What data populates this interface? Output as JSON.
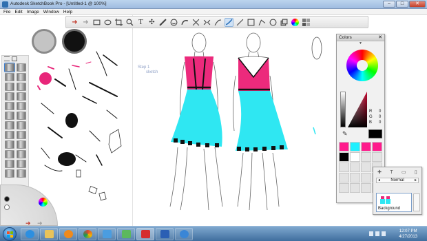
{
  "window": {
    "title": "Autodesk SketchBook Pro - [Untitled-1 @ 100%]",
    "min": "–",
    "max": "□",
    "close": "✕"
  },
  "menu": [
    "File",
    "Edit",
    "Image",
    "Window",
    "Help"
  ],
  "toolbar_icons": [
    "undo-icon",
    "redo-icon",
    "rect-select-icon",
    "lasso-icon",
    "crop-icon",
    "zoom-icon",
    "text-icon",
    "move-icon",
    "ruler-icon",
    "ellipse-guide-icon",
    "french-curve-icon",
    "perspective-icon",
    "symmetry-icon",
    "pen-icon",
    "brush-stroke-icon",
    "line-icon",
    "rect-icon",
    "polyline-icon",
    "circle-icon",
    "layer-icon",
    "color-wheel-icon",
    "brush-palette-icon"
  ],
  "canvas_labels": {
    "label_a": "Step 1",
    "label_b": "sketch"
  },
  "colors_panel": {
    "title": "Colors",
    "close": "✕",
    "collapse": "▼",
    "r_label": "R",
    "g_label": "G",
    "b_label": "B",
    "r_value": "0",
    "g_value": "0",
    "b_value": "0",
    "current_color": "#000000",
    "palette": [
      "#ff1a8c",
      "#1ff0ff",
      "#ff1a8c",
      "#ff1a8c",
      "#000000",
      "#ffffff",
      "#e3e3e3",
      "#e3e3e3"
    ]
  },
  "layers_panel": {
    "blend_mode": "Normal",
    "layer_name": "Background"
  },
  "taskbar": {
    "time": "12:07 PM",
    "date": "4/27/2013"
  },
  "accent": {
    "pink": "#e8267a",
    "cyan": "#2fe7f2",
    "brush_select": "#3d7fd0"
  }
}
